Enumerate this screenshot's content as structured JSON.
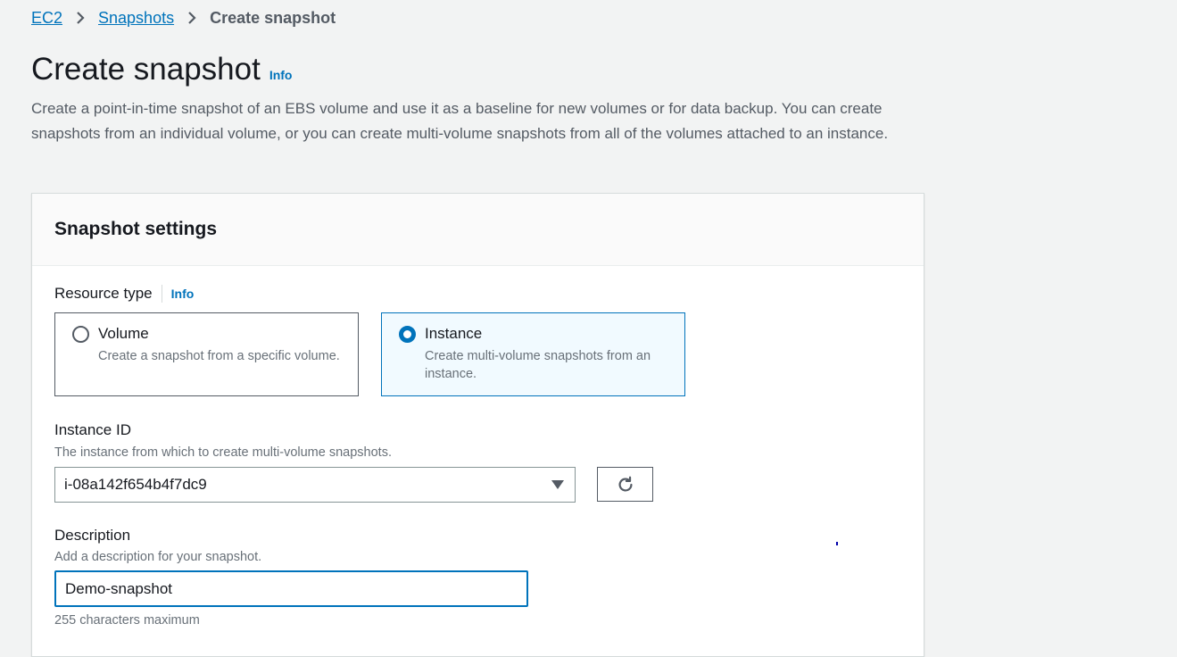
{
  "breadcrumb": {
    "items": [
      "EC2",
      "Snapshots"
    ],
    "current": "Create snapshot"
  },
  "header": {
    "title": "Create snapshot",
    "info": "Info",
    "description": "Create a point-in-time snapshot of an EBS volume and use it as a baseline for new volumes or for data backup. You can create snapshots from an individual volume, or you can create multi-volume snapshots from all of the volumes attached to an instance."
  },
  "panel": {
    "title": "Snapshot settings",
    "resource_type": {
      "label": "Resource type",
      "info": "Info",
      "options": [
        {
          "title": "Volume",
          "description": "Create a snapshot from a specific volume.",
          "selected": false
        },
        {
          "title": "Instance",
          "description": "Create multi-volume snapshots from an instance.",
          "selected": true
        }
      ]
    },
    "instance_id": {
      "label": "Instance ID",
      "description": "The instance from which to create multi-volume snapshots.",
      "value": "i-08a142f654b4f7dc9"
    },
    "description_field": {
      "label": "Description",
      "description": "Add a description for your snapshot.",
      "value": "Demo-snapshot",
      "constraint": "255 characters maximum"
    }
  },
  "icons": {
    "breadcrumb_separator": "chevron-right-icon",
    "refresh": "refresh-icon",
    "dropdown": "caret-down-icon"
  },
  "colors": {
    "link": "#0073bb",
    "selected_tile_bg": "#f1faff",
    "page_bg": "#f2f3f3"
  }
}
